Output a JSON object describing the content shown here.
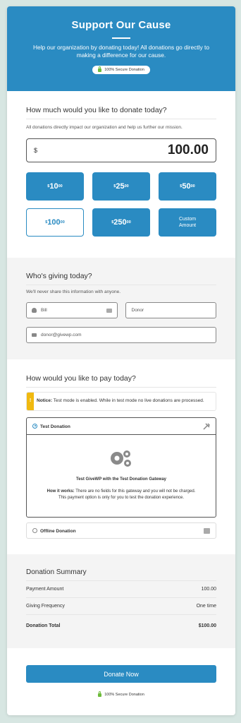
{
  "header": {
    "title": "Support Our Cause",
    "description": "Help our organization by donating today! All donations go directly to making a difference for our cause.",
    "secure_badge": "100% Secure Donation"
  },
  "amount": {
    "heading": "How much would you like to donate today?",
    "description": "All donations directly impact our organization and help us further our mission.",
    "currency": "$",
    "value": "100.00",
    "levels": [
      {
        "whole": "10",
        "cents": "00",
        "currency": "$"
      },
      {
        "whole": "25",
        "cents": "00",
        "currency": "$"
      },
      {
        "whole": "50",
        "cents": "00",
        "currency": "$"
      },
      {
        "whole": "100",
        "cents": "00",
        "currency": "$"
      },
      {
        "whole": "250",
        "cents": "00",
        "currency": "$"
      }
    ],
    "custom_label": "Custom Amount"
  },
  "donor": {
    "heading": "Who's giving today?",
    "description": "We'll never share this information with anyone.",
    "first_name": "Bill",
    "last_name": "Donor",
    "email": "donor@givewp.com"
  },
  "payment": {
    "heading": "How would you like to pay today?",
    "notice_label": "Notice:",
    "notice_text": "Test mode is enabled. While in test mode no live donations are processed.",
    "gateway_selected": "Test Donation",
    "gateway_title": "Test GiveWP with the Test Donation Gateway",
    "how_label": "How it works:",
    "how_text": "There are no fields for this gateway and you will not be charged. This payment option is only for you to test the donation experience.",
    "gateway_other": "Offline Donation"
  },
  "summary": {
    "heading": "Donation Summary",
    "rows": [
      {
        "label": "Payment Amount",
        "value": "100.00"
      },
      {
        "label": "Giving Frequency",
        "value": "One time"
      }
    ],
    "total_label": "Donation Total",
    "total_value": "$100.00"
  },
  "submit": {
    "label": "Donate Now",
    "secure_text": "100% Secure Donation"
  },
  "colors": {
    "primary": "#2a8bc2",
    "page_bg": "#d7e6e2",
    "notice": "#f0b90f",
    "secure": "#6dbb3b"
  }
}
